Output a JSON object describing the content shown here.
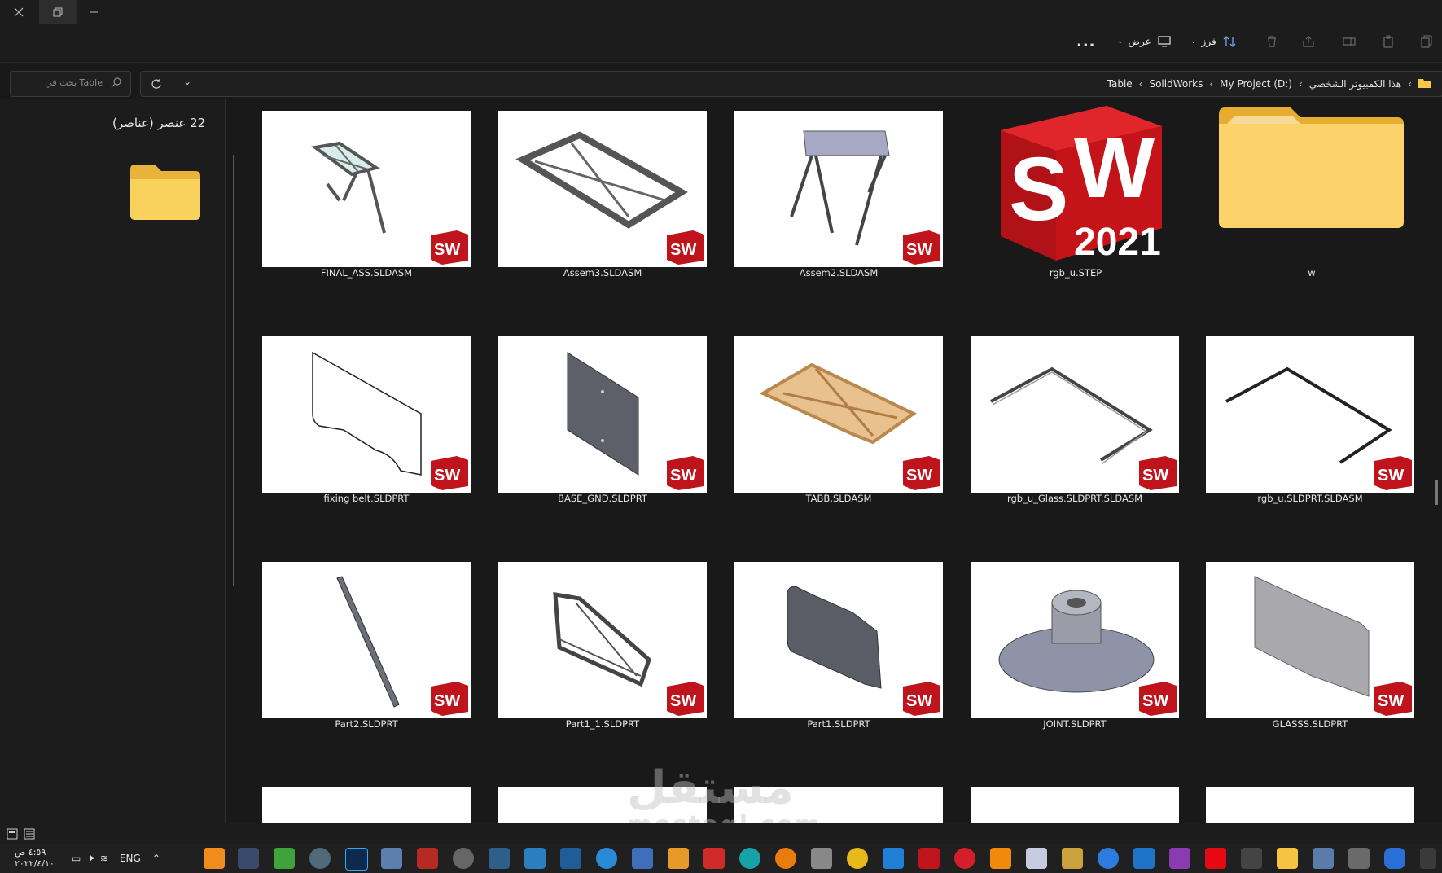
{
  "window": {
    "close_icon": "close-icon",
    "restore_icon": "restore-icon",
    "minimize_icon": "minimize-icon"
  },
  "command_bar": {
    "more_label": "...",
    "view_label": "عرض",
    "sort_label": "فرز"
  },
  "search": {
    "placeholder": "بحث في Table"
  },
  "breadcrumb": {
    "items": [
      "هذا الكمبيوتر الشخصي",
      "My Project (D:)",
      "SolidWorks",
      "Table"
    ]
  },
  "details": {
    "item_count": "22 عنصر (عناصر)"
  },
  "files": [
    {
      "name": "w"
    },
    {
      "name": "rgb_u.STEP"
    },
    {
      "name": "Assem2.SLDASM"
    },
    {
      "name": "Assem3.SLDASM"
    },
    {
      "name": "FINAL_ASS.SLDASM"
    },
    {
      "name": "rgb_u.SLDPRT.SLDASM"
    },
    {
      "name": "rgb_u_Glass.SLDPRT.SLDASM"
    },
    {
      "name": "TABB.SLDASM"
    },
    {
      "name": "BASE_GND.SLDPRT"
    },
    {
      "name": "fixing belt.SLDPRT"
    },
    {
      "name": "GLASSS.SLDPRT"
    },
    {
      "name": "JOINT.SLDPRT"
    },
    {
      "name": "Part1.SLDPRT"
    },
    {
      "name": "Part1_1.SLDPRT"
    },
    {
      "name": "Part2.SLDPRT"
    }
  ],
  "sw_logo": {
    "s": "S",
    "w": "W",
    "year": "2021"
  },
  "sw_badge": {
    "text": "SW"
  },
  "taskbar": {
    "time": "٤:٥٩ ص",
    "date": "٢٠٢٢/٤/١٠",
    "language": "ENG"
  },
  "watermark": {
    "line1": "مستقل",
    "line2": "mostaql.com"
  },
  "colors": {
    "background": "#191919",
    "sw_red": "#c0141c",
    "folder_yellow": "#f7c94b"
  }
}
